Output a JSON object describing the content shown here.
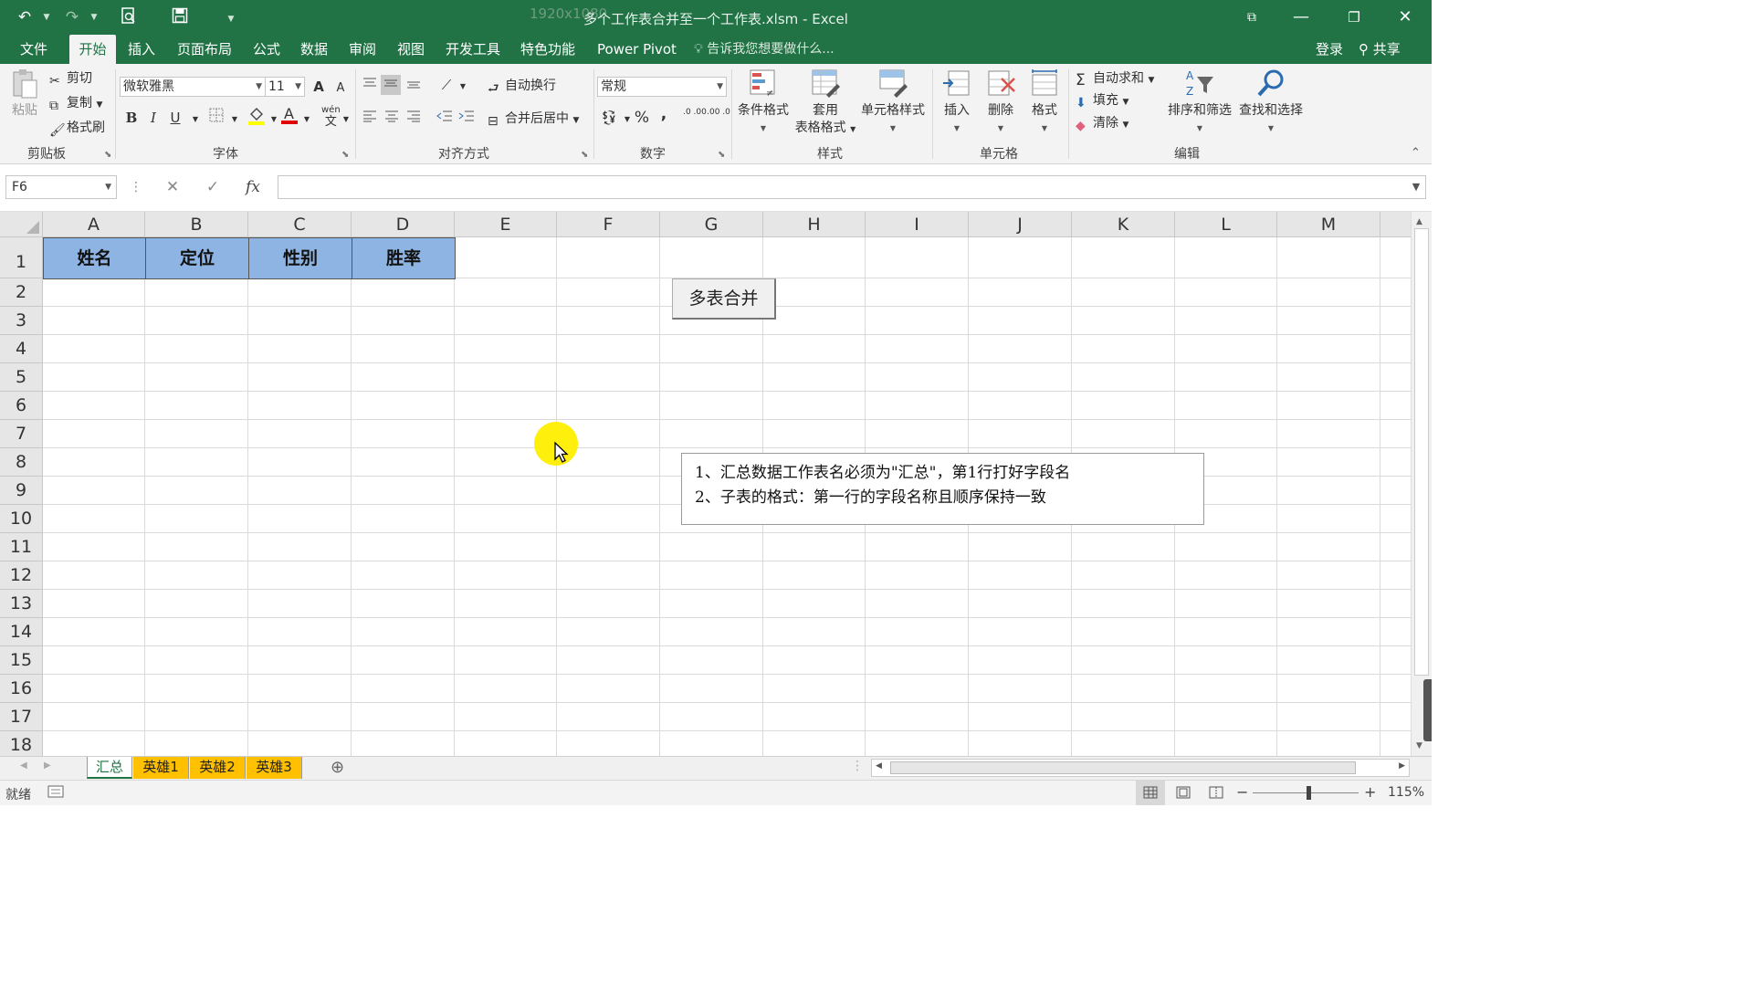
{
  "window": {
    "title": "多个工作表合并至一个工作表.xlsm - Excel",
    "overlay_text": "1920x1080"
  },
  "menu": {
    "tabs": [
      "文件",
      "开始",
      "插入",
      "页面布局",
      "公式",
      "数据",
      "审阅",
      "视图",
      "开发工具",
      "特色功能",
      "Power Pivot"
    ],
    "active_tab": "开始",
    "tell_me": "告诉我您想要做什么...",
    "login": "登录",
    "share": "共享"
  },
  "ribbon": {
    "clipboard": {
      "paste": "粘贴",
      "cut": "剪切",
      "copy": "复制",
      "format_painter": "格式刷",
      "label": "剪贴板"
    },
    "font": {
      "name": "微软雅黑",
      "size": "11",
      "bold": "B",
      "italic": "I",
      "underline": "U",
      "grow": "A",
      "shrink": "A",
      "phonetic": "wén",
      "phonetic2": "文",
      "label": "字体"
    },
    "alignment": {
      "wrap": "自动换行",
      "merge": "合并后居中",
      "label": "对齐方式"
    },
    "number": {
      "format": "常规",
      "percent": "%",
      "comma": ",",
      "inc_dec": ".0 .00",
      "dec_dec": ".00 .0",
      "label": "数字"
    },
    "styles": {
      "conditional": "条件格式",
      "table_line1": "套用",
      "table_line2": "表格格式",
      "cell_styles": "单元格样式",
      "label": "样式"
    },
    "cells": {
      "insert": "插入",
      "delete": "删除",
      "format": "格式",
      "label": "单元格"
    },
    "editing": {
      "autosum": "自动求和",
      "fill": "填充",
      "clear": "清除",
      "sort": "排序和筛选",
      "find": "查找和选择",
      "label": "编辑"
    }
  },
  "formula_bar": {
    "name_box": "F6",
    "fx": "fx",
    "cancel": "✕",
    "enter": "✓",
    "value": ""
  },
  "grid": {
    "columns": [
      "A",
      "B",
      "C",
      "D",
      "E",
      "F",
      "G",
      "H",
      "I",
      "J",
      "K",
      "L",
      "M"
    ],
    "rows": [
      "1",
      "2",
      "3",
      "4",
      "5",
      "6",
      "7",
      "8",
      "9",
      "10",
      "11",
      "12",
      "13",
      "14",
      "15",
      "16",
      "17",
      "18"
    ],
    "header_cells": [
      "姓名",
      "定位",
      "性别",
      "胜率"
    ]
  },
  "macro_button": "多表合并",
  "note": {
    "line1": "1、汇总数据工作表名必须为\"汇总\"，第1行打好字段名",
    "line2": "2、子表的格式：第一行的字段名称且顺序保持一致"
  },
  "sheets": {
    "tabs": [
      "汇总",
      "英雄1",
      "英雄2",
      "英雄3"
    ],
    "active": "汇总",
    "add": "⊕"
  },
  "status": {
    "ready": "就绪",
    "zoom": "115%",
    "minus": "−",
    "plus": "+"
  },
  "colors": {
    "excel_green": "#217346",
    "header_fill": "#8db4e2",
    "tab_orange": "#ffc000",
    "cursor_highlight": "#ffee00"
  }
}
